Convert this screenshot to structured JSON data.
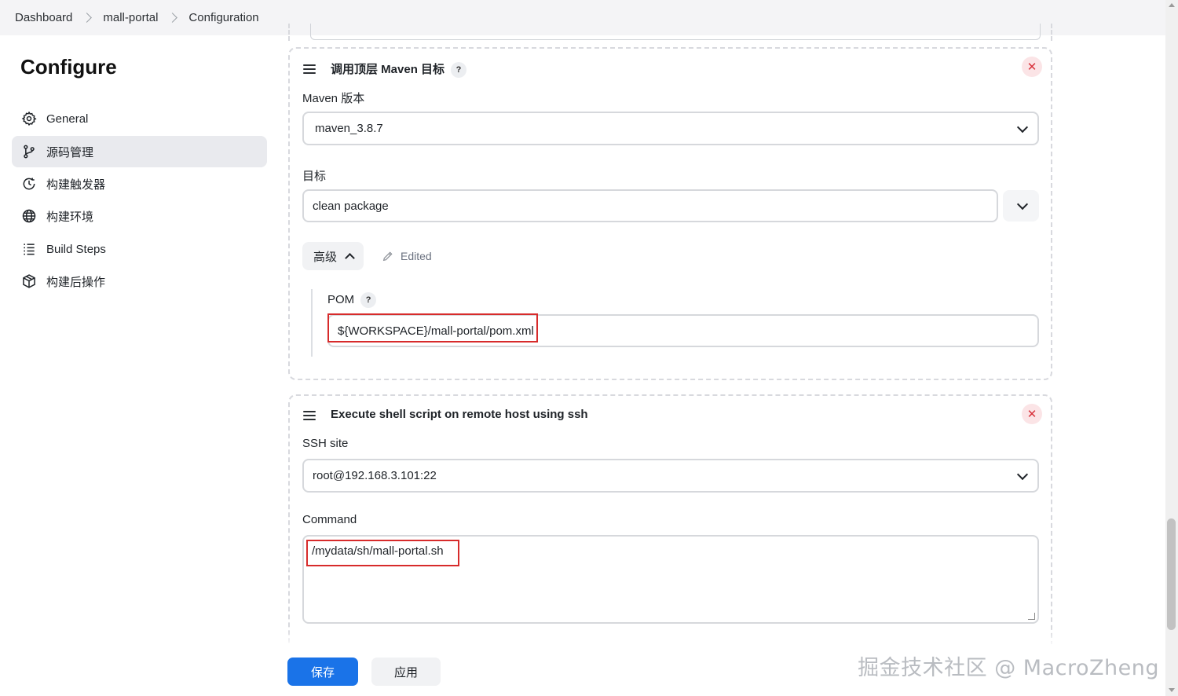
{
  "breadcrumb": [
    "Dashboard",
    "mall-portal",
    "Configuration"
  ],
  "page_title": "Configure",
  "sidebar": {
    "items": [
      {
        "label": "General",
        "icon": "gear-icon"
      },
      {
        "label": "源码管理",
        "icon": "branch-icon",
        "active": true
      },
      {
        "label": "构建触发器",
        "icon": "clock-icon"
      },
      {
        "label": "构建环境",
        "icon": "globe-icon"
      },
      {
        "label": "Build Steps",
        "icon": "list-icon"
      },
      {
        "label": "构建后操作",
        "icon": "package-icon"
      }
    ]
  },
  "maven_step": {
    "title": "调用顶层 Maven 目标",
    "help": "?",
    "close": "✕",
    "version_label": "Maven 版本",
    "version_value": "maven_3.8.7",
    "goals_label": "目标",
    "goals_value": "clean package",
    "advanced_label": "高级",
    "edited_label": "Edited",
    "pom_label": "POM",
    "pom_help": "?",
    "pom_value": "${WORKSPACE}/mall-portal/pom.xml"
  },
  "ssh_step": {
    "title": "Execute shell script on remote host using ssh",
    "close": "✕",
    "site_label": "SSH site",
    "site_value": "root@192.168.3.101:22",
    "command_label": "Command",
    "command_value": "/mydata/sh/mall-portal.sh"
  },
  "footer": {
    "save_label": "保存",
    "apply_label": "应用"
  },
  "watermark": "掘金技术社区 @ MacroZheng",
  "colors": {
    "primary": "#1a73e8",
    "highlight": "#d72b2b",
    "danger_bg": "#fbe4e6"
  }
}
